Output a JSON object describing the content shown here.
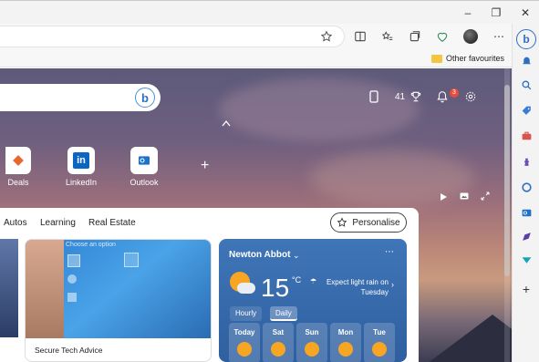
{
  "window": {
    "minimize": "–",
    "restore": "❐",
    "close": "✕"
  },
  "favourites": {
    "other_label": "Other favourites"
  },
  "header": {
    "points": "41",
    "notification_count": "3"
  },
  "quick_links": [
    {
      "label": "Deals"
    },
    {
      "label": "LinkedIn"
    },
    {
      "label": "Outlook"
    }
  ],
  "nav": {
    "items": [
      "Autos",
      "Learning",
      "Real Estate"
    ],
    "personalise": "Personalise"
  },
  "news_card": {
    "caption": "Secure Tech Advice",
    "screen_text": "Choose an option"
  },
  "weather": {
    "city": "Newton Abbot",
    "temperature": "15",
    "unit": "°C",
    "description": "Expect light rain on Tuesday",
    "tabs": [
      "Hourly",
      "Daily"
    ],
    "days": [
      "Today",
      "Sat",
      "Sun",
      "Mon",
      "Tue"
    ]
  },
  "colors": {
    "accent": "#2f6fc0",
    "badge": "#e74c3c"
  }
}
